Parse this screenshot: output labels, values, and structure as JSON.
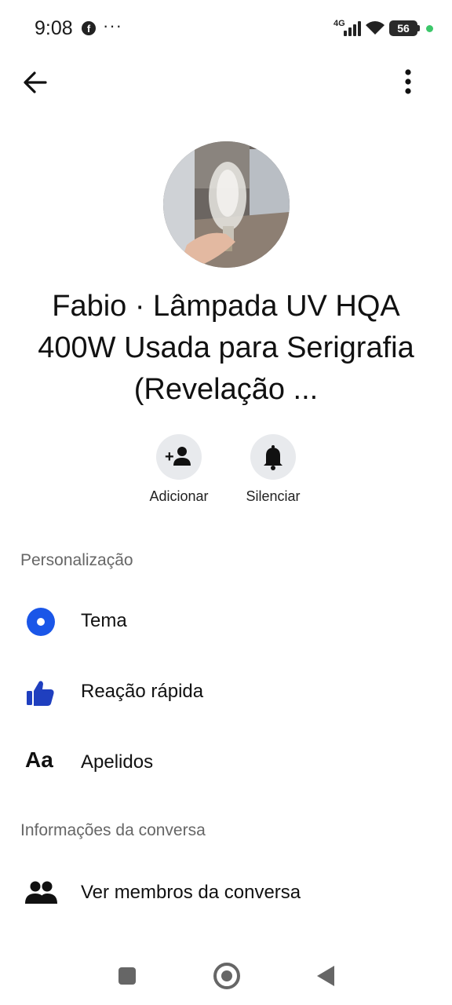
{
  "status_bar": {
    "time": "9:08",
    "notification_icon": "facebook-icon",
    "network": "4G",
    "battery": "56"
  },
  "header": {
    "back_icon": "arrow-left-icon",
    "menu_icon": "more-vertical-icon"
  },
  "profile": {
    "title": "Fabio · Lâmpada UV HQA 400W Usada para Serigrafia (Revelação ..."
  },
  "actions": [
    {
      "label": "Adicionar",
      "icon": "add-person-icon"
    },
    {
      "label": "Silenciar",
      "icon": "bell-icon"
    }
  ],
  "sections": {
    "personalization": {
      "title": "Personalização",
      "items": [
        {
          "label": "Tema",
          "icon": "theme-circle-icon"
        },
        {
          "label": "Reação rápida",
          "icon": "thumbs-up-icon"
        },
        {
          "label": "Apelidos",
          "icon": "aa-text-icon"
        }
      ]
    },
    "conversation_info": {
      "title": "Informações da conversa",
      "items": [
        {
          "label": "Ver membros da conversa",
          "icon": "people-icon"
        }
      ]
    }
  },
  "colors": {
    "accent": "#1a56e8",
    "thumbs": "#1f3fbf",
    "action_bg": "#e8eaed"
  },
  "icons_text": {
    "aa": "Aa"
  }
}
